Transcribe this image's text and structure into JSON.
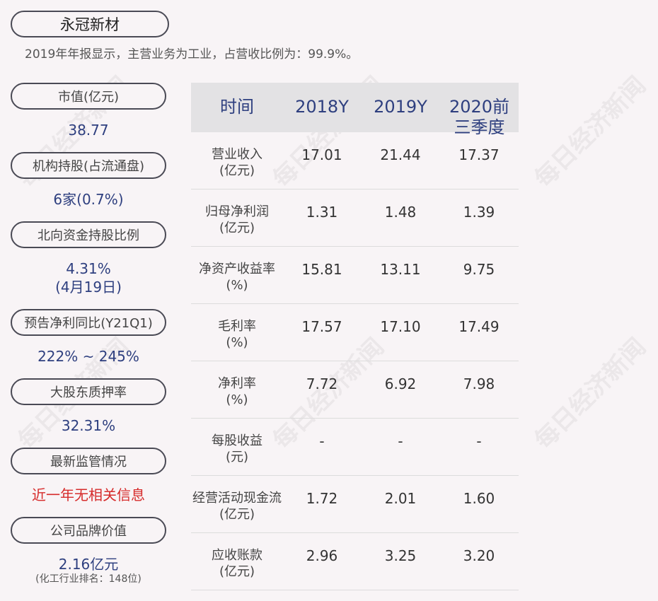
{
  "header": {
    "company": "永冠新材",
    "summary": "2019年年报显示，主营业务为工业，占营收比例为：99.9%。"
  },
  "metrics": [
    {
      "label": "市值(亿元)",
      "value": "38.77"
    },
    {
      "label": "机构持股(占流通盘)",
      "value": "6家(0.7%)"
    },
    {
      "label": "北向资金持股比例",
      "value": "4.31%",
      "value2": "(4月19日)"
    },
    {
      "label": "预告净利同比(Y21Q1)",
      "value": "222% ~ 245%"
    },
    {
      "label": "大股东质押率",
      "value": "32.31%"
    },
    {
      "label": "最新监管情况",
      "value": "近一年无相关信息"
    },
    {
      "label": "公司品牌价值",
      "value": "2.16亿元",
      "note": "(化工行业排名：148位)"
    }
  ],
  "table": {
    "headers": [
      "时间",
      "2018Y",
      "2019Y",
      "2020前三季度"
    ],
    "rows": [
      {
        "label1": "营业收入",
        "label2": "(亿元)",
        "values": [
          "17.01",
          "21.44",
          "17.37"
        ]
      },
      {
        "label1": "归母净利润",
        "label2": "(亿元)",
        "values": [
          "1.31",
          "1.48",
          "1.39"
        ]
      },
      {
        "label1": "净资产收益率",
        "label2": "(%)",
        "values": [
          "15.81",
          "13.11",
          "9.75"
        ]
      },
      {
        "label1": "毛利率",
        "label2": "(%)",
        "values": [
          "17.57",
          "17.10",
          "17.49"
        ]
      },
      {
        "label1": "净利率",
        "label2": "(%)",
        "values": [
          "7.72",
          "6.92",
          "7.98"
        ]
      },
      {
        "label1": "每股收益",
        "label2": "(元)",
        "values": [
          "-",
          "-",
          "-"
        ]
      },
      {
        "label1": "经营活动现金流",
        "label2": "(亿元)",
        "values": [
          "1.72",
          "2.01",
          "1.60"
        ]
      },
      {
        "label1": "应收账款",
        "label2": "(亿元)",
        "values": [
          "2.96",
          "3.25",
          "3.20"
        ]
      }
    ]
  },
  "watermark": "每日经济新闻"
}
